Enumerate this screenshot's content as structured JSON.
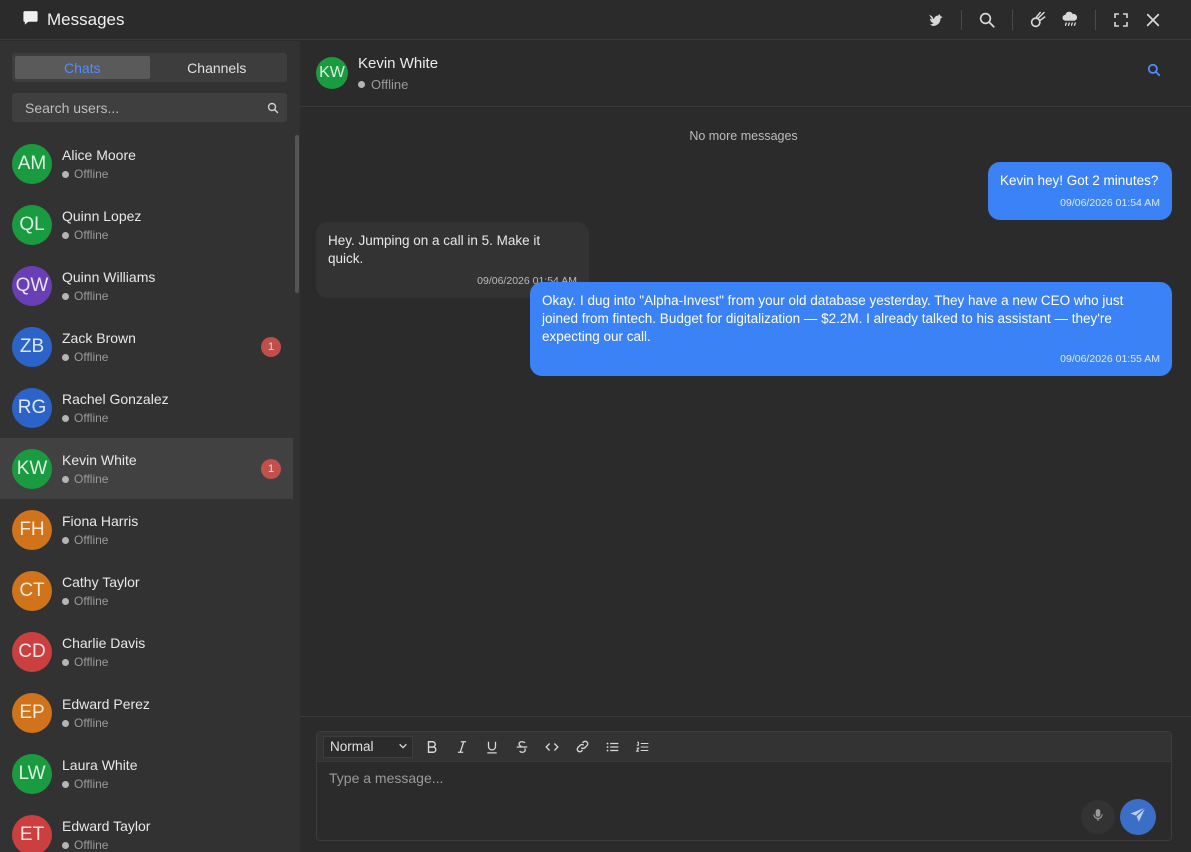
{
  "window": {
    "title": "Messages"
  },
  "sidebar": {
    "tabs": [
      {
        "label": "Chats",
        "active": true
      },
      {
        "label": "Channels",
        "active": false
      }
    ],
    "search": {
      "placeholder": "Search users..."
    },
    "users": [
      {
        "initials": "AM",
        "name": "Alice Moore",
        "status": "Offline",
        "color": "#1a9b3f",
        "badge": ""
      },
      {
        "initials": "QL",
        "name": "Quinn Lopez",
        "status": "Offline",
        "color": "#1a9b3f",
        "badge": ""
      },
      {
        "initials": "QW",
        "name": "Quinn Williams",
        "status": "Offline",
        "color": "#6a3fb5",
        "badge": ""
      },
      {
        "initials": "ZB",
        "name": "Zack Brown",
        "status": "Offline",
        "color": "#2b63c9",
        "badge": "1"
      },
      {
        "initials": "RG",
        "name": "Rachel Gonzalez",
        "status": "Offline",
        "color": "#2b63c9",
        "badge": ""
      },
      {
        "initials": "KW",
        "name": "Kevin White",
        "status": "Offline",
        "color": "#1a9b3f",
        "badge": "1",
        "active": true
      },
      {
        "initials": "FH",
        "name": "Fiona Harris",
        "status": "Offline",
        "color": "#d0731a",
        "badge": ""
      },
      {
        "initials": "CT",
        "name": "Cathy Taylor",
        "status": "Offline",
        "color": "#d0731a",
        "badge": ""
      },
      {
        "initials": "CD",
        "name": "Charlie Davis",
        "status": "Offline",
        "color": "#cc3f3f",
        "badge": ""
      },
      {
        "initials": "EP",
        "name": "Edward Perez",
        "status": "Offline",
        "color": "#d0731a",
        "badge": ""
      },
      {
        "initials": "LW",
        "name": "Laura White",
        "status": "Offline",
        "color": "#1a9b3f",
        "badge": ""
      },
      {
        "initials": "ET",
        "name": "Edward Taylor",
        "status": "Offline",
        "color": "#cc3f3f",
        "badge": ""
      }
    ]
  },
  "chat": {
    "contact": {
      "initials": "KW",
      "name": "Kevin White",
      "status": "Offline",
      "color": "#1a9b3f"
    },
    "no_more": "No more messages",
    "messages": [
      {
        "direction": "out",
        "text": "Kevin  hey! Got 2 minutes?",
        "time": "09/06/2026 01:54 AM"
      },
      {
        "direction": "in",
        "text": "Hey. Jumping on a call in 5. Make it quick.",
        "time": "09/06/2026 01:54 AM"
      },
      {
        "direction": "out",
        "text": "Okay. I dug into \"Alpha-Invest\" from your old database yesterday. They have a new CEO who just joined from fintech. Budget for digitalization — $2.2M. I already talked to his assistant — they're expecting our call.",
        "time": "09/06/2026 01:55 AM"
      }
    ],
    "composer": {
      "format": "Normal",
      "placeholder": "Type a message..."
    }
  },
  "colors": {
    "accent": "#3b82f6",
    "badge": "#d9534f"
  }
}
